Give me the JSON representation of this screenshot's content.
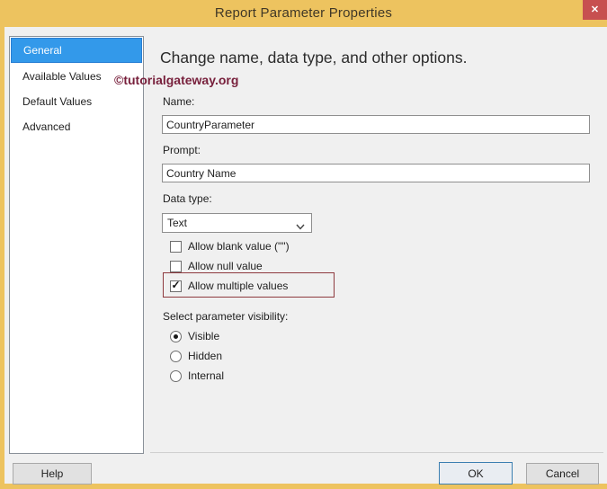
{
  "window": {
    "title": "Report Parameter Properties",
    "close_glyph": "✕"
  },
  "colors": {
    "frame_orange": "#edc35f",
    "close_red": "#c75050",
    "client_bg": "#f0f0f0",
    "selected_item_blue": "#3399ea",
    "watermark_maroon": "#771f3b",
    "annotation_maroon": "#8e3a3f",
    "ok_focus_border_blue": "#3c7fb1"
  },
  "sidebar": {
    "items": [
      {
        "label": "General",
        "selected": true
      },
      {
        "label": "Available Values",
        "selected": false
      },
      {
        "label": "Default Values",
        "selected": false
      },
      {
        "label": "Advanced",
        "selected": false
      }
    ]
  },
  "main": {
    "heading": "Change name, data type, and other options.",
    "watermark": "©tutorialgateway.org",
    "name_label": "Name:",
    "name_value": "CountryParameter",
    "prompt_label": "Prompt:",
    "prompt_value": "Country Name",
    "data_type_label": "Data type:",
    "data_type_value": "Text",
    "checkboxes": [
      {
        "label": "Allow blank value (\"\")",
        "checked": false
      },
      {
        "label": "Allow null value",
        "checked": false
      },
      {
        "label": "Allow multiple values",
        "checked": true,
        "highlighted": true
      }
    ],
    "visibility_label": "Select parameter visibility:",
    "radios": [
      {
        "label": "Visible",
        "selected": true
      },
      {
        "label": "Hidden",
        "selected": false
      },
      {
        "label": "Internal",
        "selected": false
      }
    ]
  },
  "footer": {
    "help_label": "Help",
    "ok_label": "OK",
    "cancel_label": "Cancel"
  }
}
